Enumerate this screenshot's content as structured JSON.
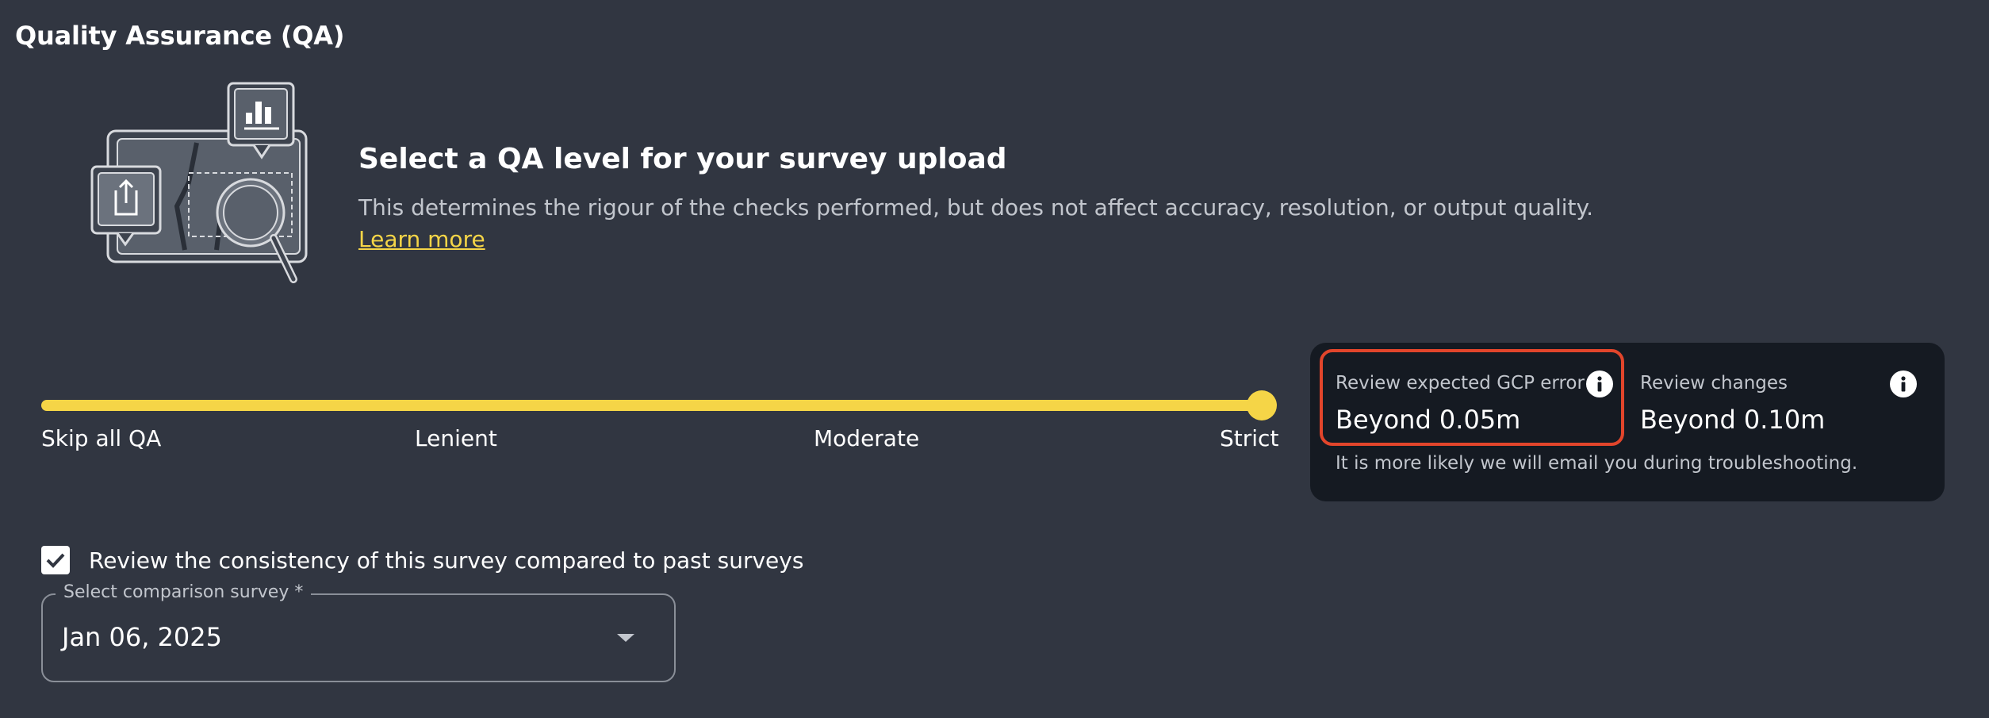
{
  "page": {
    "title": "Quality Assurance (QA)"
  },
  "intro": {
    "heading": "Select a QA level for your survey upload",
    "description": "This determines the rigour of the checks performed, but does not affect accuracy, resolution, or output quality.",
    "learn_more": "Learn more",
    "illustration_icon": "survey-upload-inspection-illustration"
  },
  "qa_slider": {
    "levels": [
      "Skip all QA",
      "Lenient",
      "Moderate",
      "Strict"
    ],
    "selected": "Strict",
    "value_fraction": 1.0
  },
  "qa_details": {
    "gcp": {
      "label": "Review expected GCP error",
      "value": "Beyond 0.05m"
    },
    "changes": {
      "label": "Review changes",
      "value": "Beyond 0.10m"
    },
    "note": "It is more likely we will email you during troubleshooting."
  },
  "consistency": {
    "label": "Review the consistency of this survey compared to past surveys",
    "checked": true
  },
  "comparison_survey": {
    "label": "Select comparison survey *",
    "value": "Jan 06, 2025"
  },
  "colors": {
    "background": "#313641",
    "accent": "#f5d547",
    "panel": "#151a22",
    "highlight": "#e2452b"
  }
}
